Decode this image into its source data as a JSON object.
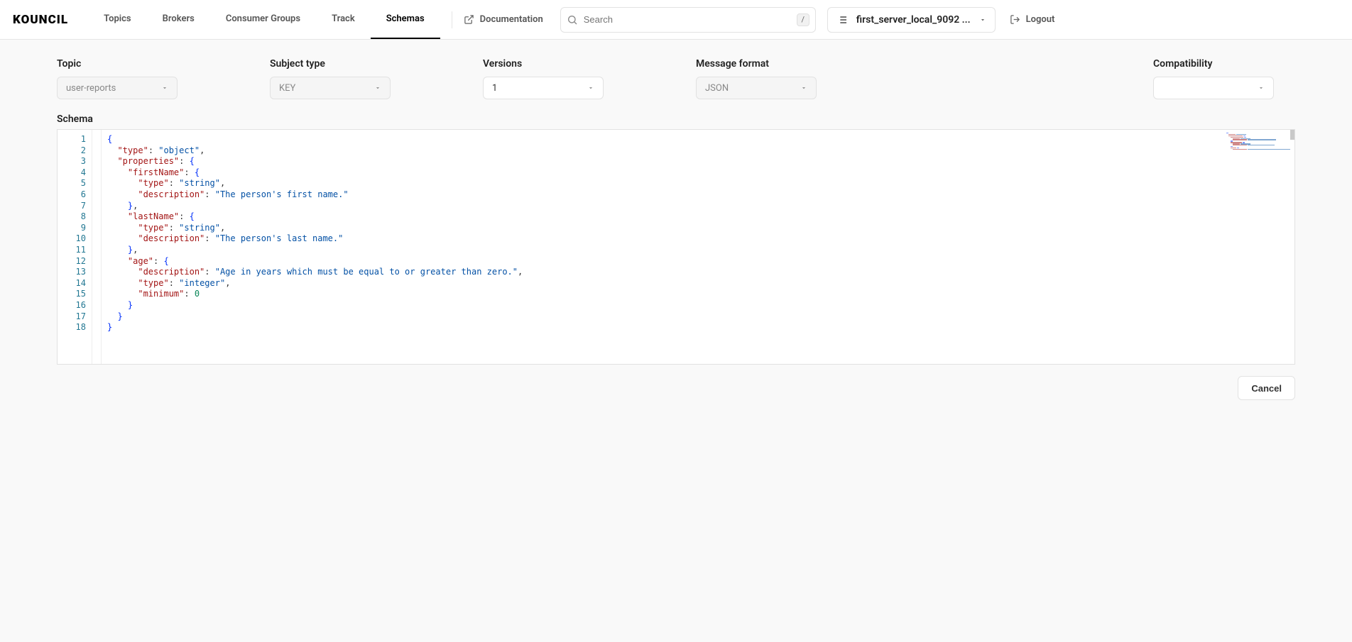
{
  "app": {
    "logo": "KOUNCIL"
  },
  "nav": {
    "topics": "Topics",
    "brokers": "Brokers",
    "consumer_groups": "Consumer Groups",
    "track": "Track",
    "schemas": "Schemas",
    "documentation": "Documentation"
  },
  "search": {
    "placeholder": "Search",
    "shortcut": "/"
  },
  "server": {
    "label": "first_server_local_9092 ..."
  },
  "logout": "Logout",
  "filters": {
    "topic": {
      "label": "Topic",
      "value": "user-reports"
    },
    "subject_type": {
      "label": "Subject type",
      "value": "KEY"
    },
    "versions": {
      "label": "Versions",
      "value": "1"
    },
    "message_format": {
      "label": "Message format",
      "value": "JSON"
    },
    "compatibility": {
      "label": "Compatibility",
      "value": ""
    }
  },
  "schema": {
    "label": "Schema",
    "lines": [
      "1",
      "2",
      "3",
      "4",
      "5",
      "6",
      "7",
      "8",
      "9",
      "10",
      "11",
      "12",
      "13",
      "14",
      "15",
      "16",
      "17",
      "18"
    ],
    "json": {
      "type": "object",
      "properties": {
        "firstName": {
          "type": "string",
          "description": "The person's first name."
        },
        "lastName": {
          "type": "string",
          "description": "The person's last name."
        },
        "age": {
          "description": "Age in years which must be equal to or greater than zero.",
          "type": "integer",
          "minimum": 0
        }
      }
    }
  },
  "actions": {
    "cancel": "Cancel"
  }
}
